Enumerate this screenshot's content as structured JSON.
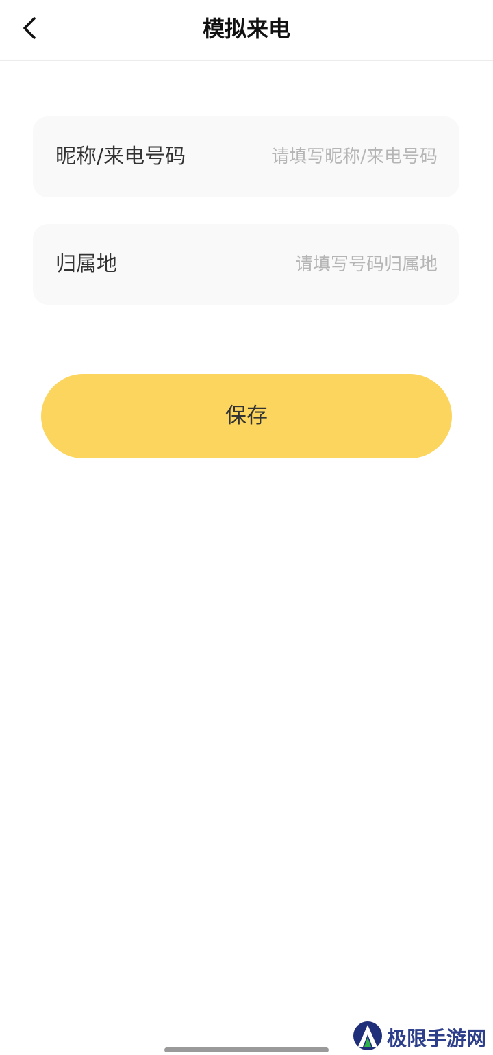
{
  "header": {
    "title": "模拟来电",
    "back_icon": "chevron-left-icon"
  },
  "form": {
    "nickname": {
      "label": "昵称/来电号码",
      "value": "",
      "placeholder": "请填写昵称/来电号码"
    },
    "location": {
      "label": "归属地",
      "value": "",
      "placeholder": "请填写号码归属地"
    }
  },
  "actions": {
    "save_label": "保存"
  },
  "watermark": {
    "text": "极限手游网",
    "logo_icon": "site-logo-icon"
  },
  "colors": {
    "accent": "#fbd55e",
    "row_background": "#f9f9f9",
    "placeholder": "#b5b5b5",
    "watermark": "#2d3f8a"
  }
}
